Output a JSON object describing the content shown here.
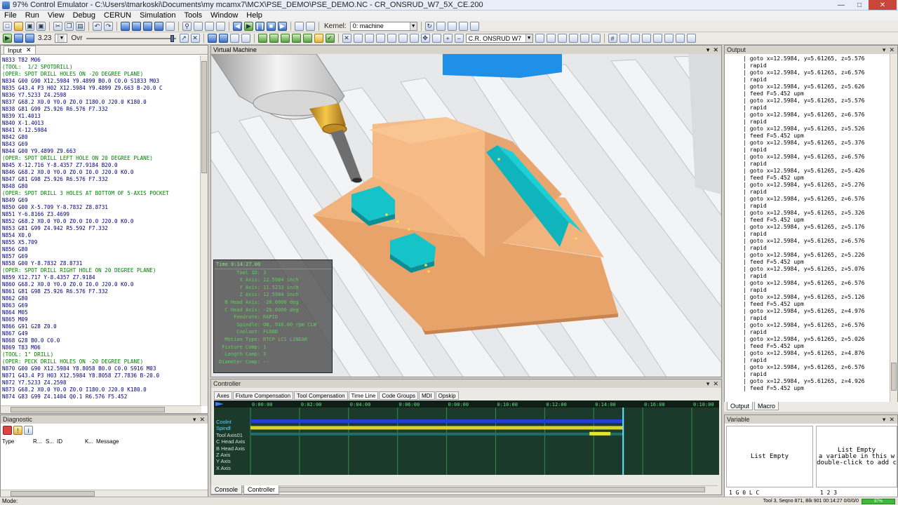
{
  "window": {
    "title": "97% Control Emulator - C:\\Users\\tmarkoski\\Documents\\my mcamx7\\MCX\\PSE_DEMO\\PSE_DEMO.NC - CR_ONSRUD_W7_5X_CE.200"
  },
  "menu": [
    "File",
    "Run",
    "View",
    "Debug",
    "CERUN",
    "Simulation",
    "Tools",
    "Window",
    "Help"
  ],
  "toolbar": {
    "zoom_value": "3.23",
    "ovr_label": "Ovr",
    "kernel_label": "Kernel:",
    "kernel_value": "0: machine",
    "machine_value": "C.R. ONSRUD W7"
  },
  "input_panel": {
    "tab_label": "Input",
    "lines": [
      {
        "text": "N833 T82 M06",
        "color": "#000080"
      },
      {
        "text": "(TOOL:  1/2 SPOTDRILL)",
        "color": "#008000"
      },
      {
        "text": "(OPER: SPOT DRILL HOLES ON -20 DEGREE PLANE)",
        "color": "#008000"
      },
      {
        "text": "N834 G00 G90 X12.5984 Y9.4899 B0.0 C0.0 S1833 M03",
        "color": "#000080"
      },
      {
        "text": "N835 G43.4 P3 H02 X12.5984 Y9.4899 Z9.663 B-20.0 C",
        "color": "#000080"
      },
      {
        "text": "N836 Y7.5233 Z4.2598",
        "color": "#000080"
      },
      {
        "text": "N837 G68.2 X0.0 Y0.0 Z0.0 I180.0 J20.0 K180.0",
        "color": "#000080"
      },
      {
        "text": "N838 G81 G99 Z5.926 R6.576 F7.332",
        "color": "#000080"
      },
      {
        "text": "N839 X1.4013",
        "color": "#000080"
      },
      {
        "text": "N840 X-1.4013",
        "color": "#000080"
      },
      {
        "text": "N841 X-12.5984",
        "color": "#000080"
      },
      {
        "text": "N842 G80",
        "color": "#000080"
      },
      {
        "text": "N843 G69",
        "color": "#000080"
      },
      {
        "text": "N844 G00 Y9.4899 Z9.663",
        "color": "#000080"
      },
      {
        "text": "(OPER: SPOT DRILL LEFT HOLE ON 20 DEGREE PLANE)",
        "color": "#008000"
      },
      {
        "text": "N845 X-12.716 Y-8.4357 Z7.9184 B20.0",
        "color": "#000080"
      },
      {
        "text": "N846 G68.2 X0.0 Y0.0 Z0.0 I0.0 J20.0 K0.0",
        "color": "#000080"
      },
      {
        "text": "N847 G81 G98 Z5.926 R6.576 F7.332",
        "color": "#000080"
      },
      {
        "text": "N848 G80",
        "color": "#000080"
      },
      {
        "text": "(OPER: SPOT DRILL 3 HOLES AT BOTTOM OF 5-AXIS POCKET",
        "color": "#008000"
      },
      {
        "text": "N849 G69",
        "color": "#000080"
      },
      {
        "text": "N850 G00 X-5.709 Y-8.7832 Z8.8731",
        "color": "#000080"
      },
      {
        "text": "N851 Y-6.8166 Z3.4699",
        "color": "#000080"
      },
      {
        "text": "N852 G68.2 X0.0 Y0.0 Z0.0 I0.0 J20.0 K0.0",
        "color": "#000080"
      },
      {
        "text": "N853 G81 G99 Z4.942 R5.592 F7.332",
        "color": "#000080"
      },
      {
        "text": "N854 X0.0",
        "color": "#000080"
      },
      {
        "text": "N855 X5.709",
        "color": "#000080"
      },
      {
        "text": "N856 G80",
        "color": "#000080"
      },
      {
        "text": "N857 G69",
        "color": "#000080"
      },
      {
        "text": "N858 G00 Y-8.7832 Z8.8731",
        "color": "#000080"
      },
      {
        "text": "(OPER: SPOT DRILL RIGHT HOLE ON 20 DEGREE PLANE)",
        "color": "#008000"
      },
      {
        "text": "N859 X12.717 Y-8.4357 Z7.9184",
        "color": "#000080"
      },
      {
        "text": "N860 G68.2 X0.0 Y0.0 Z0.0 I0.0 J20.0 K0.0",
        "color": "#000080"
      },
      {
        "text": "N861 G81 G98 Z5.926 R6.576 F7.332",
        "color": "#000080"
      },
      {
        "text": "N862 G80",
        "color": "#000080"
      },
      {
        "text": "N863 G69",
        "color": "#000080"
      },
      {
        "text": "N864 M05",
        "color": "#000080"
      },
      {
        "text": "N865 M09",
        "color": "#000080"
      },
      {
        "text": "N866 G91 G28 Z0.0",
        "color": "#000080"
      },
      {
        "text": "N867 G49",
        "color": "#000080"
      },
      {
        "text": "N868 G28 B0.0 C0.0",
        "color": "#000080"
      },
      {
        "text": "N869 T83 M06",
        "color": "#000080"
      },
      {
        "text": "(TOOL: 1\" DRILL)",
        "color": "#008000"
      },
      {
        "text": "(OPER: PECK DRILL HOLES ON -20 DEGREE PLANE)",
        "color": "#008000"
      },
      {
        "text": "N870 G00 G90 X12.5984 Y8.8058 B0.0 C0.0 S916 M03",
        "color": "#000080"
      },
      {
        "text": "N871 G43.4 P3 H03 X12.5984 Y8.8058 Z7.7836 B-20.0",
        "color": "#000080"
      },
      {
        "text": "N872 Y7.5233 Z4.2598",
        "color": "#000080"
      },
      {
        "text": "N873 G68.2 X0.0 Y0.0 Z0.0 I180.0 J20.0 K180.0",
        "color": "#000080"
      },
      {
        "text": "N874 G83 G99 Z4.1404 Q0.1 R6.576 F5.452",
        "color": "#000080"
      }
    ]
  },
  "diagnostic_panel": {
    "title": "Diagnostic",
    "columns": [
      "Type",
      "R...",
      "S...",
      "ID",
      "K...",
      "Message"
    ]
  },
  "virtual_machine": {
    "title": "Virtual Machine",
    "hud": {
      "header": "Time  0:14:27.00",
      "rows": [
        {
          "label": "Tool ID:",
          "value": "3"
        },
        {
          "label": "X Axis:",
          "value": "12.5984 inch"
        },
        {
          "label": "Y Axis:",
          "value": "11.5233 inch"
        },
        {
          "label": "Z Axis:",
          "value": "12.5984 inch"
        },
        {
          "label": "B Head Axis:",
          "value": "-20.0000 deg"
        },
        {
          "label": "C Head Axis:",
          "value": "-20.0000 deg"
        },
        {
          "label": "Feedrate:",
          "value": "RAPID"
        },
        {
          "label": "Spindle:",
          "value": "ON, 916.00 rpm CLW"
        },
        {
          "label": "Coolant:",
          "value": "FLOOD"
        },
        {
          "label": "Motion Type:",
          "value": "RTCP LCS LINEAR"
        },
        {
          "label": "Fixture Comp:",
          "value": "1"
        },
        {
          "label": "Length Comp:",
          "value": "3"
        },
        {
          "label": "Diameter Comp:",
          "value": "--"
        }
      ]
    }
  },
  "output_panel": {
    "title": "Output",
    "lines": [
      "     | goto x=12.5984, y=5.61265, z=5.576",
      "     | rapid",
      "     | goto x=12.5984, y=5.61265, z=6.576",
      "     | rapid",
      "     | goto x=12.5984, y=5.61265, z=5.626",
      "     | feed F=5.452 upm",
      "     | goto x=12.5984, y=5.61265, z=5.576",
      "     | rapid",
      "     | goto x=12.5984, y=5.61265, z=6.576",
      "     | rapid",
      "     | goto x=12.5984, y=5.61265, z=5.526",
      "     | feed F=5.452 upm",
      "     | goto x=12.5984, y=5.61265, z=5.376",
      "     | rapid",
      "     | goto x=12.5984, y=5.61265, z=6.576",
      "     | rapid",
      "     | goto x=12.5984, y=5.61265, z=5.426",
      "     | feed F=5.452 upm",
      "     | goto x=12.5984, y=5.61265, z=5.276",
      "     | rapid",
      "     | goto x=12.5984, y=5.61265, z=6.576",
      "     | rapid",
      "     | goto x=12.5984, y=5.61265, z=5.326",
      "     | feed F=5.452 upm",
      "     | goto x=12.5984, y=5.61265, z=5.176",
      "     | rapid",
      "     | goto x=12.5984, y=5.61265, z=6.576",
      "     | rapid",
      "     | goto x=12.5984, y=5.61265, z=5.226",
      "     | feed F=5.452 upm",
      "     | goto x=12.5984, y=5.61265, z=5.076",
      "     | rapid",
      "     | goto x=12.5984, y=5.61265, z=6.576",
      "     | rapid",
      "     | goto x=12.5984, y=5.61265, z=5.126",
      "     | feed F=5.452 upm",
      "     | goto x=12.5984, y=5.61265, z=4.976",
      "     | rapid",
      "     | goto x=12.5984, y=5.61265, z=6.576",
      "     | rapid",
      "     | goto x=12.5984, y=5.61265, z=5.026",
      "     | feed F=5.452 upm",
      "     | goto x=12.5984, y=5.61265, z=4.876",
      "     | rapid",
      "     | goto x=12.5984, y=5.61265, z=6.576",
      "     | rapid",
      "     | goto x=12.5984, y=5.61265, z=4.926",
      "     | feed F=5.452 upm"
    ],
    "tabs": [
      "Output",
      "Macro"
    ]
  },
  "variable_panel": {
    "title": "Variable",
    "left_text": "List Empty",
    "right_line1": "List Empty",
    "right_line2": "a variable in this w",
    "right_line3": "double-click to add c",
    "left_tabs": "1 G 0 L C",
    "right_tabs": "1 2 3"
  },
  "controller": {
    "title": "Controller",
    "tabs": [
      "Axes",
      "Fixture Compensation",
      "Tool Compensation",
      "Time Line",
      "Code Groups",
      "MDI",
      "Opskip"
    ],
    "active_tab": "Time Line",
    "time_ticks": [
      "0:00:00",
      "0:02:00",
      "0:04:00",
      "0:06:00",
      "0:00:00",
      "0:10:00",
      "0:12:00",
      "0:14:00",
      "0:16:00",
      "0:10:00"
    ],
    "tracks": [
      "Coolnt",
      "Spindl",
      "Tool Axis01",
      "C Head Axis",
      "B Head Axis",
      "Z Axis",
      "Y Axis",
      "X Axis"
    ],
    "progress_fraction": 0.8
  },
  "bottom_tabs": [
    "Console",
    "Controller"
  ],
  "statusbar": {
    "left": "Mode:",
    "right": "Tool 3, Seqno 871, Blk 901  00:14:27  0/0/0/0",
    "progress": "97%"
  }
}
